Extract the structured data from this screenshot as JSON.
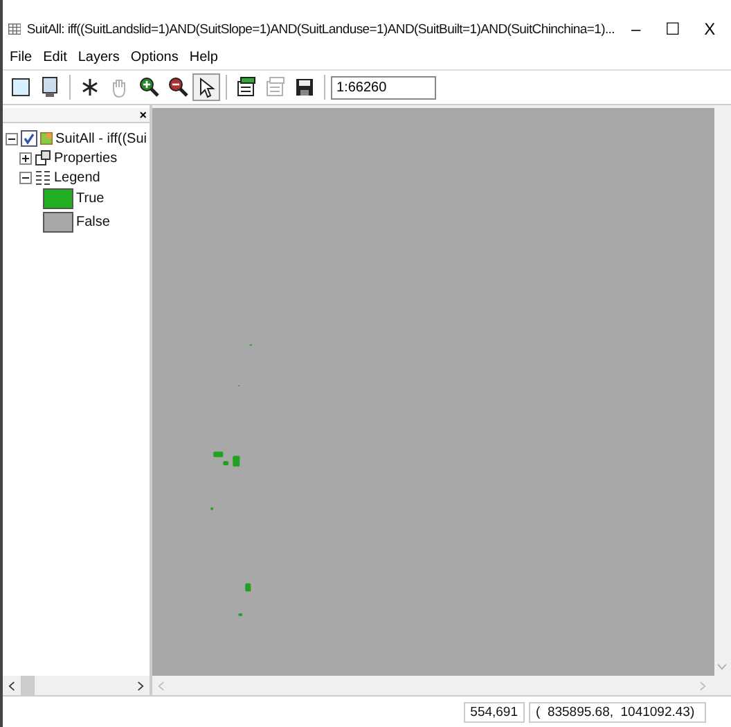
{
  "window": {
    "title": "SuitAll: iff((SuitLandslid=1)AND(SuitSlope=1)AND(SuitLanduse=1)AND(SuitBuilt=1)AND(SuitChinchina=1)...",
    "controls": [
      "–",
      "☐",
      "X"
    ]
  },
  "menu": [
    "File",
    "Edit",
    "Layers",
    "Options",
    "Help"
  ],
  "toolbar": [
    {
      "kind": "page",
      "disabled": false,
      "selected": false
    },
    {
      "kind": "monitor",
      "disabled": false,
      "selected": false
    },
    {
      "kind": "sep"
    },
    {
      "kind": "asterisk",
      "disabled": false,
      "selected": false
    },
    {
      "kind": "hand",
      "disabled": true,
      "selected": false
    },
    {
      "kind": "zoomin",
      "disabled": false,
      "selected": false
    },
    {
      "kind": "zoomout",
      "disabled": false,
      "selected": false
    },
    {
      "kind": "pointer",
      "disabled": false,
      "selected": true
    },
    {
      "kind": "sep"
    },
    {
      "kind": "addlayer",
      "disabled": false,
      "selected": false
    },
    {
      "kind": "layer",
      "disabled": true,
      "selected": false
    },
    {
      "kind": "save",
      "disabled": false,
      "selected": false
    }
  ],
  "scale": {
    "value": "1:66260"
  },
  "panel_close": "×",
  "tree": {
    "label": "SuitAll - iff((Sui",
    "checked": true,
    "expanded": true,
    "children": [
      {
        "label": "Properties",
        "kind": "properties",
        "expanded": false
      },
      {
        "label": "Legend",
        "kind": "legend",
        "expanded": true,
        "children": [
          {
            "label": "True",
            "color": "#22b022"
          },
          {
            "label": "False",
            "color": "#a8a8a8"
          }
        ]
      }
    ]
  },
  "status_bar": {
    "pixel": "554,691",
    "coords": "(  835895.68,  1041092.43)"
  }
}
